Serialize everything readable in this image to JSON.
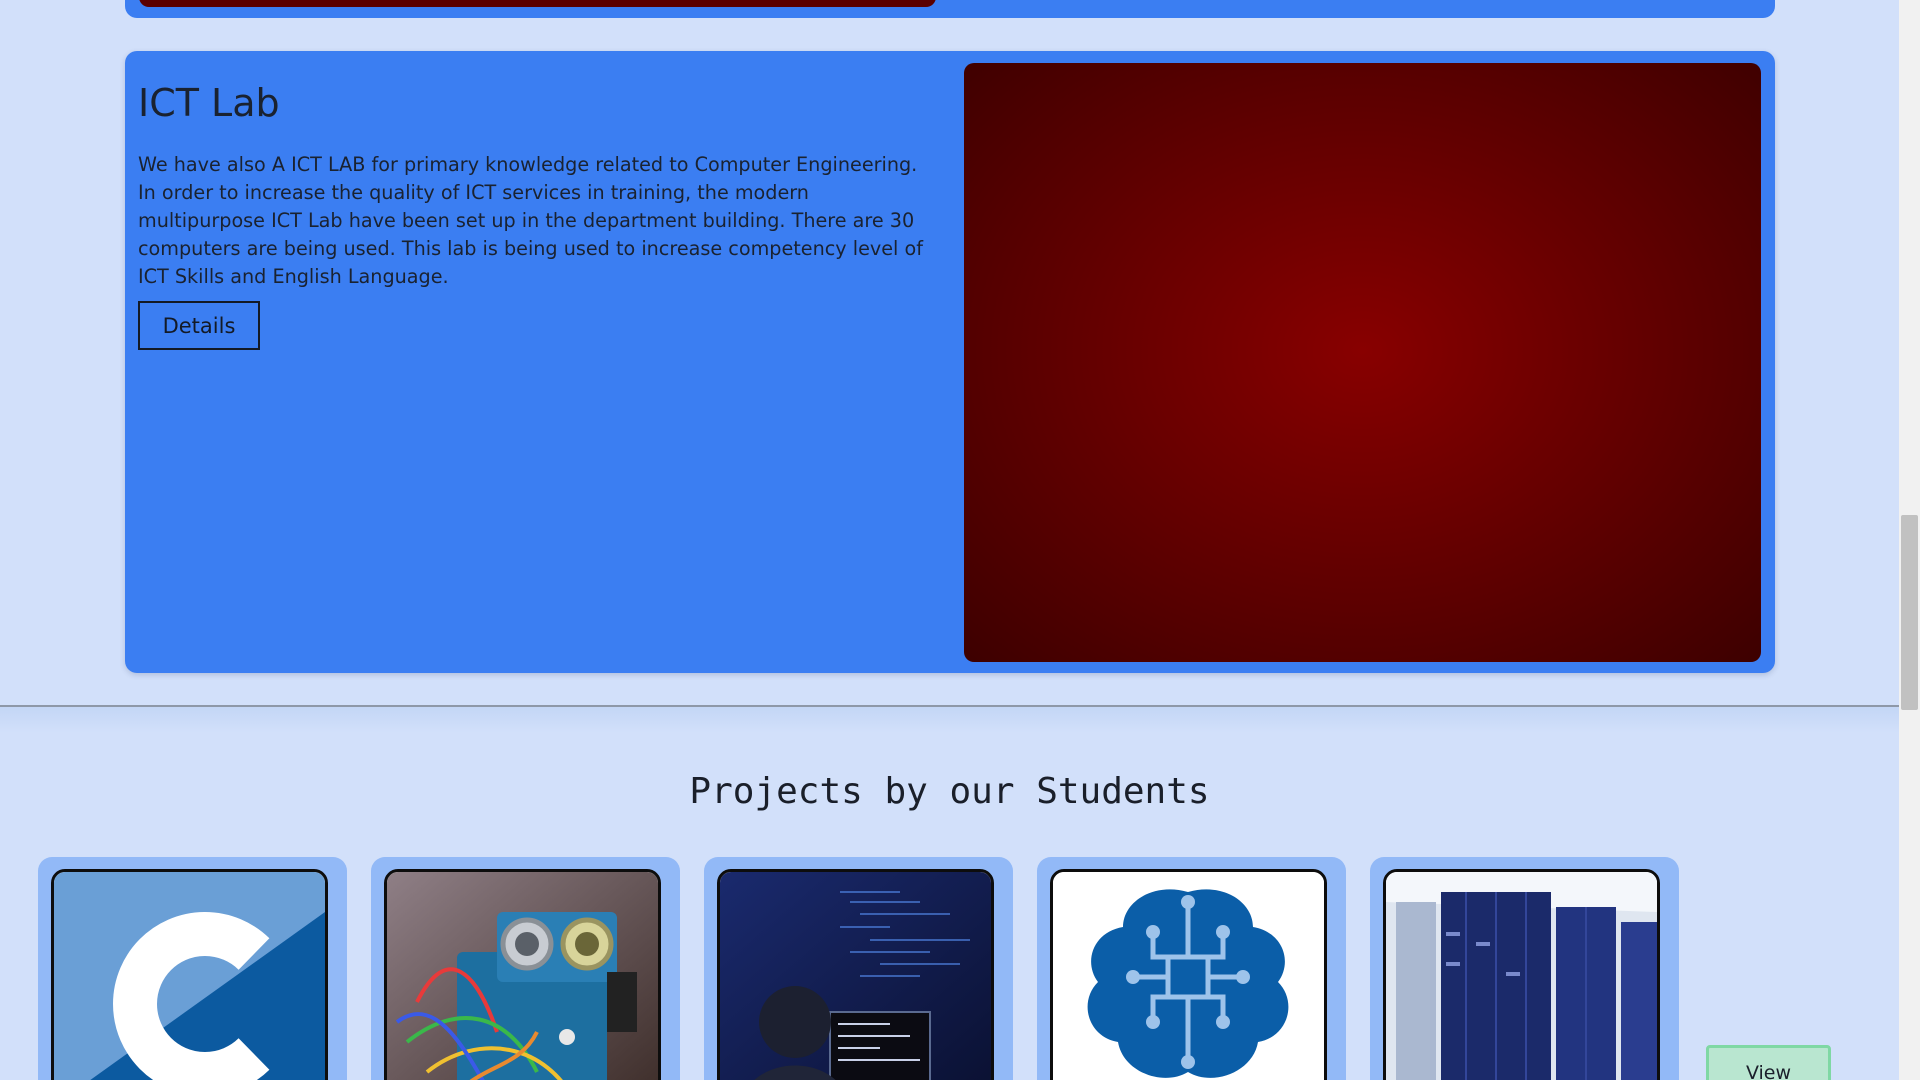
{
  "lab": {
    "title": "ICT Lab",
    "description": "We have also A ICT LAB for primary knowledge related to Computer Engineering. In order to increase the quality of ICT services in training, the modern multipurpose ICT Lab have been set up in the department building. There are 30 computers are being used. This lab is being used to increase competency level of ICT Skills and English Language.",
    "details_label": "Details"
  },
  "projects": {
    "heading": "Projects by our Students",
    "view_label": "View",
    "items": [
      {
        "icon": "c-language-logo-icon"
      },
      {
        "icon": "arduino-robot-icon"
      },
      {
        "icon": "programmer-screen-icon"
      },
      {
        "icon": "ai-brain-circuit-icon"
      },
      {
        "icon": "server-rack-icon"
      }
    ]
  },
  "colors": {
    "page_background": "#d2e0fa",
    "card_blue": "#3b7ef2",
    "project_card": "#92b9f7",
    "view_button": "#b9e6d0",
    "media_red": "#880000"
  }
}
